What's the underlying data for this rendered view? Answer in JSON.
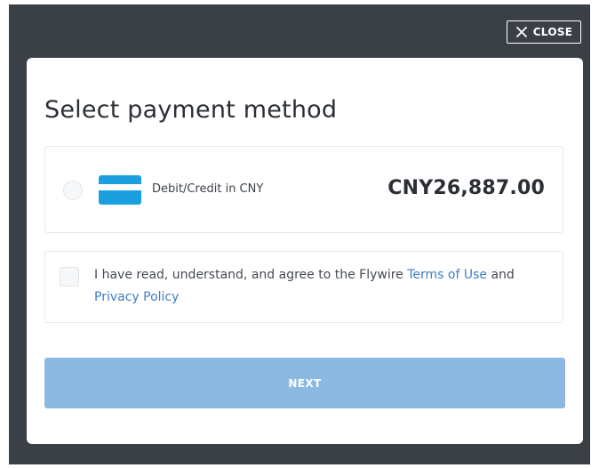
{
  "header": {
    "close_label": "CLOSE",
    "close_icon": "close-icon"
  },
  "modal": {
    "title": "Select payment method",
    "payment_option": {
      "icon": "credit-card-icon",
      "label": "Debit/Credit in CNY",
      "amount": "CNY26,887.00",
      "selected": false
    },
    "agreement": {
      "text_before": "I have read, understand, and agree to the Flywire ",
      "terms_link": "Terms of Use",
      "text_middle": " and ",
      "privacy_link": "Privacy Policy",
      "checked": false
    },
    "next_label": "NEXT"
  },
  "colors": {
    "backdrop": "#3b4047",
    "card_icon": "#1a9fe0",
    "link": "#3d7fc2",
    "next_button": "#8cb9e1"
  }
}
